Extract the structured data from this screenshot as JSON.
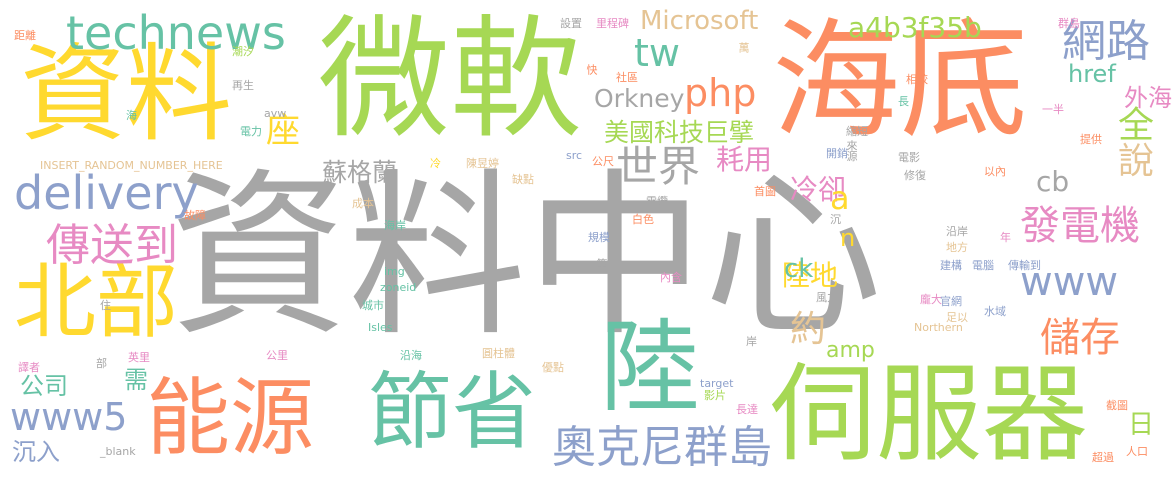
{
  "colors": {
    "gray": "#a6a6a6",
    "lime": "#a6d854",
    "orange": "#fc8d62",
    "yellow": "#ffd92f",
    "teal": "#66c2a5",
    "blue": "#8da0cb",
    "pink": "#e78ac3",
    "tan": "#e5c494"
  },
  "words": {
    "w1": "資料中心",
    "w2": "微軟",
    "w3": "海底",
    "w4": "資料",
    "w5": "伺服器",
    "w6": "能源",
    "w7": "節省",
    "w8": "陸",
    "w9": "北部",
    "w10": "technews",
    "w11": "delivery",
    "w12": "傳送到",
    "w13": "奧克尼群島",
    "w14": "發電機",
    "w15": "網路",
    "w16": "世界",
    "w17": "php",
    "w18": "tw",
    "w19": "Microsoft",
    "w20": "a4b3f35b",
    "w21": "美國科技巨擘",
    "w22": "www5",
    "w23": "儲存",
    "w24": "www",
    "w25": "蘇格蘭",
    "w26": "Orkney",
    "w27": "說",
    "w28": "全",
    "w29": "座",
    "w30": "耗用",
    "w31": "冷卻",
    "w32": "陸地",
    "w33": "約",
    "w34": "外海",
    "w35": "href",
    "w36": "cb",
    "w37": "a",
    "w38": "ck",
    "w39": "n",
    "w40": "amp",
    "w41": "公司",
    "w42": "需",
    "w43": "沉入",
    "w44": "日",
    "w45": "INSERT_RANDOM_NUMBER_HERE",
    "w46": "距離",
    "w47": "潮汐",
    "w48": "再生",
    "w49": "電力",
    "w50": "海",
    "w51": "avw",
    "w52": "故障",
    "w53": "住",
    "w54": "譯者",
    "w55": "部",
    "w56": "英里",
    "w57": "公里",
    "w58": "_blank",
    "w59": "設置",
    "w60": "里程碑",
    "w61": "萬",
    "w62": "群島",
    "w63": "快",
    "w64": "社區",
    "w65": "相較",
    "w66": "長",
    "w67": "一半",
    "w68": "縮短",
    "w69": "開銷",
    "w70": "src",
    "w71": "公尺",
    "w72": "陳昱婷",
    "w73": "缺點",
    "w74": "來源",
    "w75": "電影",
    "w76": "以內",
    "w77": "提供",
    "w78": "修復",
    "w79": "成本",
    "w80": "海岸",
    "w81": "電纜",
    "w82": "首圖",
    "w83": "白色",
    "w84": "規模",
    "w85": "沉",
    "w86": "沿岸",
    "w87": "地方",
    "w88": "年",
    "w89": "建構",
    "w90": "電腦",
    "w91": "傳輸到",
    "w92": "img",
    "w93": "zoneid",
    "w94": "筆",
    "w95": "內含",
    "w96": "城市",
    "w97": "風力",
    "w98": "龐大",
    "w99": "官網",
    "w100": "足以",
    "w101": "水域",
    "w102": "Isles",
    "w103": "Northern",
    "w104": "岸",
    "w105": "沿海",
    "w106": "圓柱體",
    "w107": "優點",
    "w108": "target",
    "w109": "影片",
    "w110": "長達",
    "w111": "截圖",
    "w112": "超過",
    "w113": "人口",
    "w114": "冷"
  }
}
